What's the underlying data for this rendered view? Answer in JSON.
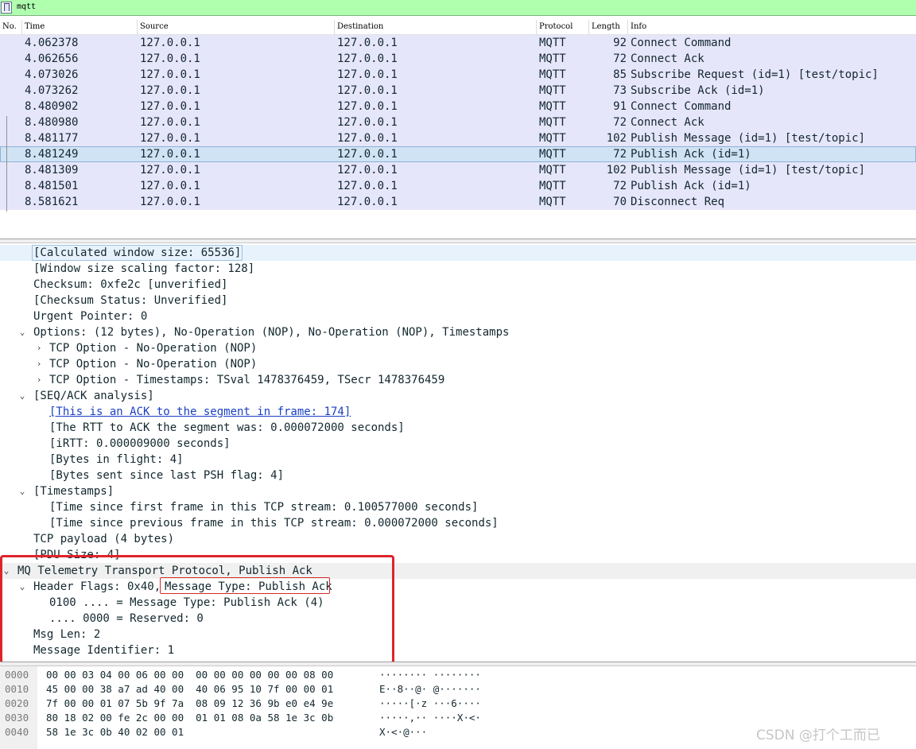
{
  "filter": {
    "value": "mqtt"
  },
  "packet_list": {
    "columns": [
      "No.",
      "Time",
      "Source",
      "Destination",
      "Protocol",
      "Length",
      "Info"
    ],
    "rows": [
      {
        "time": "4.062378",
        "src": "127.0.0.1",
        "dst": "127.0.0.1",
        "proto": "MQTT",
        "len": "92",
        "info": "Connect Command"
      },
      {
        "time": "4.062656",
        "src": "127.0.0.1",
        "dst": "127.0.0.1",
        "proto": "MQTT",
        "len": "72",
        "info": "Connect Ack"
      },
      {
        "time": "4.073026",
        "src": "127.0.0.1",
        "dst": "127.0.0.1",
        "proto": "MQTT",
        "len": "85",
        "info": "Subscribe Request (id=1) [test/topic]"
      },
      {
        "time": "4.073262",
        "src": "127.0.0.1",
        "dst": "127.0.0.1",
        "proto": "MQTT",
        "len": "73",
        "info": "Subscribe Ack (id=1)"
      },
      {
        "time": "8.480902",
        "src": "127.0.0.1",
        "dst": "127.0.0.1",
        "proto": "MQTT",
        "len": "91",
        "info": "Connect Command"
      },
      {
        "time": "8.480980",
        "src": "127.0.0.1",
        "dst": "127.0.0.1",
        "proto": "MQTT",
        "len": "72",
        "info": "Connect Ack"
      },
      {
        "time": "8.481177",
        "src": "127.0.0.1",
        "dst": "127.0.0.1",
        "proto": "MQTT",
        "len": "102",
        "info": "Publish Message (id=1) [test/topic]"
      },
      {
        "time": "8.481249",
        "src": "127.0.0.1",
        "dst": "127.0.0.1",
        "proto": "MQTT",
        "len": "72",
        "info": "Publish Ack (id=1)"
      },
      {
        "time": "8.481309",
        "src": "127.0.0.1",
        "dst": "127.0.0.1",
        "proto": "MQTT",
        "len": "102",
        "info": "Publish Message (id=1) [test/topic]"
      },
      {
        "time": "8.481501",
        "src": "127.0.0.1",
        "dst": "127.0.0.1",
        "proto": "MQTT",
        "len": "72",
        "info": "Publish Ack (id=1)"
      },
      {
        "time": "8.581621",
        "src": "127.0.0.1",
        "dst": "127.0.0.1",
        "proto": "MQTT",
        "len": "70",
        "info": "Disconnect Req"
      }
    ],
    "selected_time": "8.481249"
  },
  "details": {
    "lines": [
      "[Calculated window size: 65536]",
      "[Window size scaling factor: 128]",
      "Checksum: 0xfe2c [unverified]",
      "[Checksum Status: Unverified]",
      "Urgent Pointer: 0",
      "Options: (12 bytes), No-Operation (NOP), No-Operation (NOP), Timestamps",
      "TCP Option - No-Operation (NOP)",
      "TCP Option - No-Operation (NOP)",
      "TCP Option - Timestamps: TSval 1478376459, TSecr 1478376459",
      "[SEQ/ACK analysis]",
      "[This is an ACK to the segment in frame: 174]",
      "[The RTT to ACK the segment was: 0.000072000 seconds]",
      "[iRTT: 0.000009000 seconds]",
      "[Bytes in flight: 4]",
      "[Bytes sent since last PSH flag: 4]",
      "[Timestamps]",
      "[Time since first frame in this TCP stream: 0.100577000 seconds]",
      "[Time since previous frame in this TCP stream: 0.000072000 seconds]",
      "TCP payload (4 bytes)",
      "[PDU Size: 4]",
      "MQ Telemetry Transport Protocol, Publish Ack",
      "Header Flags: 0x40,",
      "Message Type: Publish Ack",
      "0100 .... = Message Type: Publish Ack (4)",
      ".... 0000 = Reserved: 0",
      "Msg Len: 2",
      "Message Identifier: 1"
    ],
    "carets": {
      "expanded": "⌄",
      "collapsed": "›"
    }
  },
  "bytes": {
    "rows": [
      {
        "off": "0000",
        "hex": "00 00 03 04 00 06 00 00  00 00 00 00 00 00 08 00",
        "ascii": "········ ········"
      },
      {
        "off": "0010",
        "hex": "45 00 00 38 a7 ad 40 00  40 06 95 10 7f 00 00 01",
        "ascii": "E··8··@· @·······"
      },
      {
        "off": "0020",
        "hex": "7f 00 00 01 07 5b 9f 7a  08 09 12 36 9b e0 e4 9e",
        "ascii": "·····[·z ···6····"
      },
      {
        "off": "0030",
        "hex": "80 18 02 00 fe 2c 00 00  01 01 08 0a 58 1e 3c 0b",
        "ascii": "·····,·· ····X·<·"
      },
      {
        "off": "0040",
        "hex": "58 1e 3c 0b 40 02 00 01",
        "ascii": "X·<·@···"
      }
    ]
  },
  "watermark": "CSDN @打个工而已"
}
